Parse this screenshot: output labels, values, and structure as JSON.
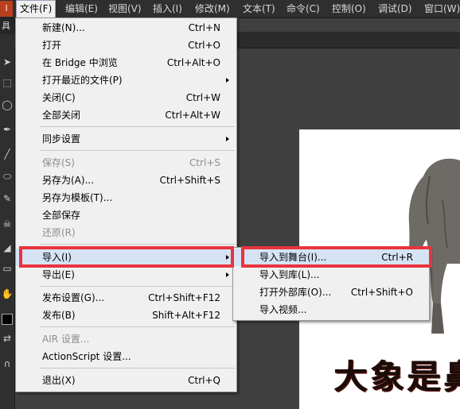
{
  "menubar": {
    "logo": "l",
    "items": [
      {
        "label": "文件(F)"
      },
      {
        "label": "编辑(E)"
      },
      {
        "label": "视图(V)"
      },
      {
        "label": "插入(I)"
      },
      {
        "label": "修改(M)"
      },
      {
        "label": "文本(T)"
      },
      {
        "label": "命令(C)"
      },
      {
        "label": "控制(O)"
      },
      {
        "label": "调试(D)"
      },
      {
        "label": "窗口(W)"
      }
    ]
  },
  "toolbar": {
    "header": "具"
  },
  "file_menu": {
    "items": [
      {
        "label": "新建(N)...",
        "shortcut": "Ctrl+N"
      },
      {
        "label": "打开",
        "shortcut": "Ctrl+O"
      },
      {
        "label": "在 Bridge 中浏览",
        "shortcut": "Ctrl+Alt+O"
      },
      {
        "label": "打开最近的文件(P)",
        "shortcut": ""
      },
      {
        "label": "关闭(C)",
        "shortcut": "Ctrl+W"
      },
      {
        "label": "全部关闭",
        "shortcut": "Ctrl+Alt+W"
      },
      {
        "label": "同步设置",
        "shortcut": ""
      },
      {
        "label": "保存(S)",
        "shortcut": "Ctrl+S"
      },
      {
        "label": "另存为(A)...",
        "shortcut": "Ctrl+Shift+S"
      },
      {
        "label": "另存为模板(T)...",
        "shortcut": ""
      },
      {
        "label": "全部保存",
        "shortcut": ""
      },
      {
        "label": "还原(R)",
        "shortcut": ""
      },
      {
        "label": "导入(I)",
        "shortcut": ""
      },
      {
        "label": "导出(E)",
        "shortcut": ""
      },
      {
        "label": "发布设置(G)...",
        "shortcut": "Ctrl+Shift+F12"
      },
      {
        "label": "发布(B)",
        "shortcut": "Shift+Alt+F12"
      },
      {
        "label": "AIR 设置...",
        "shortcut": ""
      },
      {
        "label": "ActionScript 设置...",
        "shortcut": ""
      },
      {
        "label": "退出(X)",
        "shortcut": "Ctrl+Q"
      }
    ]
  },
  "import_submenu": {
    "items": [
      {
        "label": "导入到舞台(I)...",
        "shortcut": "Ctrl+R"
      },
      {
        "label": "导入到库(L)...",
        "shortcut": ""
      },
      {
        "label": "打开外部库(O)...",
        "shortcut": "Ctrl+Shift+O"
      },
      {
        "label": "导入视频...",
        "shortcut": ""
      }
    ]
  },
  "stage": {
    "calligraphy": "大象是鼻"
  },
  "colors": {
    "highlight_box": "#e8343c",
    "menu_bg": "#f0f0f0",
    "hover_bg": "#d5e3f5"
  }
}
